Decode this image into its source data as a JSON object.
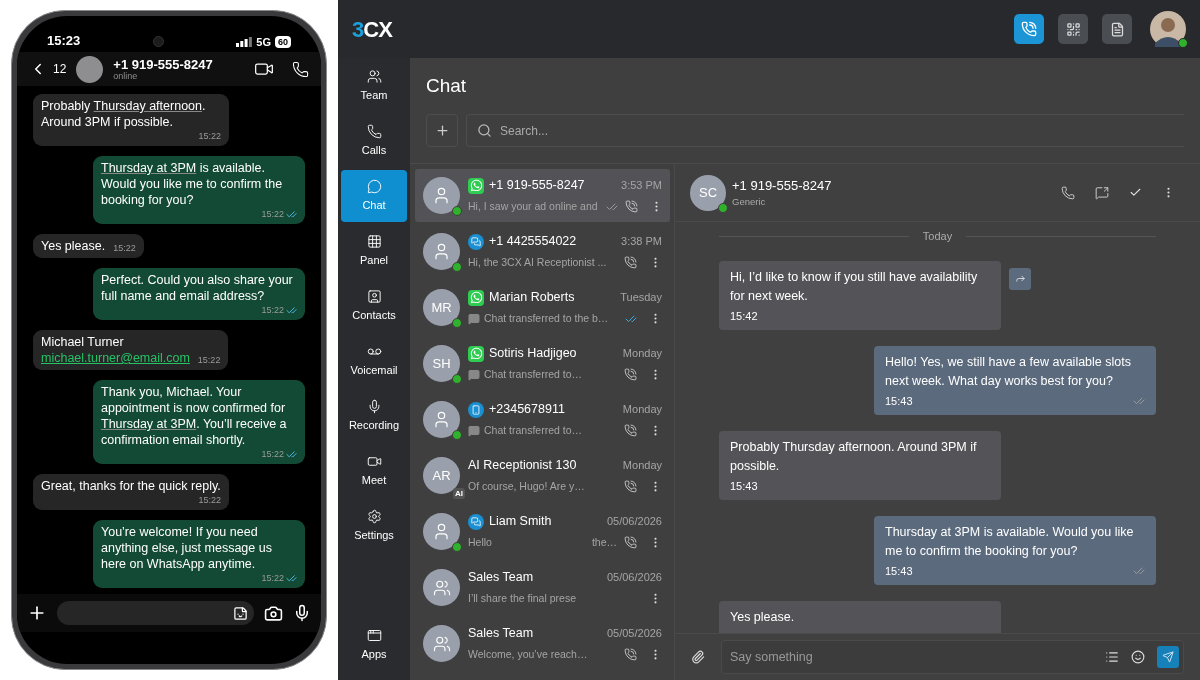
{
  "phone": {
    "status_bar": {
      "time": "15:23",
      "network": "5G",
      "battery": "60"
    },
    "header": {
      "back_count": "12",
      "contact": "+1 919-555-8247",
      "presence": "online"
    },
    "messages": [
      {
        "kind": "incoming",
        "parts": [
          {
            "text": "Probably "
          },
          {
            "text": "Thursday afternoon",
            "underlined": true
          },
          {
            "text": ". Around 3PM if possible.",
            "underlined": false
          }
        ],
        "time": "15:22"
      },
      {
        "kind": "outgoing",
        "parts": [
          {
            "text": "Thursday at 3PM",
            "underlined": true
          },
          {
            "text": " is available. Would you like me to confirm the booking for you?",
            "underlined": false
          }
        ],
        "time": "15:22",
        "read": true
      },
      {
        "kind": "incoming",
        "parts": [
          {
            "text": "Yes please.",
            "underlined": false
          }
        ],
        "time": "15:22"
      },
      {
        "kind": "outgoing",
        "parts": [
          {
            "text": "Perfect. Could you also share your full name and email address?",
            "underlined": false
          }
        ],
        "time": "15:22",
        "read": true
      },
      {
        "kind": "incoming",
        "parts": [
          {
            "text": "Michael Turner",
            "underlined": false
          },
          {
            "kind": "link",
            "text": "michael.turner@email.com"
          }
        ],
        "time": "15:22"
      },
      {
        "kind": "outgoing",
        "parts": [
          {
            "text": "Thank you, Michael. Your appointment is now confirmed for ",
            "underlined": false
          },
          {
            "text": "Thursday at 3PM",
            "underlined": true
          },
          {
            "text": ". You’ll receive a confirmation email shortly.",
            "underlined": false
          }
        ],
        "time": "15:22",
        "read": true
      },
      {
        "kind": "incoming",
        "parts": [
          {
            "text": "Great, thanks for the quick reply.",
            "underlined": false
          }
        ],
        "time": "15:22"
      },
      {
        "kind": "outgoing",
        "parts": [
          {
            "text": "You’re welcome! If you need anything else, just message us here on WhatsApp anytime.",
            "underlined": false
          }
        ],
        "time": "15:22",
        "read": true
      }
    ]
  },
  "app": {
    "logo": "3CX",
    "nav": [
      {
        "label": "Team",
        "selected": false
      },
      {
        "label": "Calls",
        "selected": false
      },
      {
        "label": "Chat",
        "selected": true
      },
      {
        "label": "Panel",
        "selected": false
      },
      {
        "label": "Contacts",
        "selected": false
      },
      {
        "label": "Voicemail",
        "selected": false
      },
      {
        "label": "Recording",
        "selected": false
      },
      {
        "label": "Meet",
        "selected": false
      },
      {
        "label": "Settings",
        "selected": false
      }
    ],
    "nav_bottom": {
      "label": "Apps"
    },
    "page_title": "Chat",
    "search": {
      "placeholder": "Search..."
    },
    "chats": [
      {
        "name": "+1 919-555-8247",
        "channel": {
          "kind": "whatsapp"
        },
        "avatar": {
          "kind": "person"
        },
        "online": true,
        "time": "3:53 PM",
        "preview": {
          "text": "Hi, I saw your ad online and"
        },
        "ticks": true,
        "read": false,
        "call": true,
        "selected": true
      },
      {
        "name": "+1 4425554022",
        "channel": {
          "kind": "livechat"
        },
        "avatar": {
          "kind": "person"
        },
        "online": true,
        "time": "3:38 PM",
        "preview": {
          "text": "Hi, the 3CX AI Receptionist ..."
        },
        "ticks": false,
        "call": true,
        "selected": false
      },
      {
        "name": "Marian Roberts",
        "channel": {
          "kind": "whatsapp"
        },
        "avatar": {
          "kind": "initials",
          "initials": "MR"
        },
        "online": true,
        "time": "Tuesday",
        "preview": {
          "kind": "transfer",
          "text": "Chat transferred to the b…"
        },
        "ticks": true,
        "read": true,
        "call": false,
        "selected": false
      },
      {
        "name": "Sotiris Hadjigeo",
        "channel": {
          "kind": "whatsapp"
        },
        "avatar": {
          "kind": "initials",
          "initials": "SH"
        },
        "online": true,
        "time": "Monday",
        "preview": {
          "kind": "transfer",
          "text": "Chat transferred to…"
        },
        "ticks": false,
        "call": true,
        "selected": false
      },
      {
        "name": "+2345678911",
        "channel": {
          "kind": "sms"
        },
        "avatar": {
          "kind": "person"
        },
        "online": true,
        "time": "Monday",
        "preview": {
          "kind": "transfer",
          "text": "Chat transferred to…"
        },
        "ticks": false,
        "call": true,
        "selected": false
      },
      {
        "name": "AI Receptionist 130",
        "avatar": {
          "kind": "initials",
          "initials": "AR",
          "badge": "AI"
        },
        "online": false,
        "time": "Monday",
        "preview": {
          "text": "Of course, Hugo! Are y…"
        },
        "ticks": false,
        "call": true,
        "selected": false
      },
      {
        "name": "Liam Smith",
        "channel": {
          "kind": "livechat"
        },
        "avatar": {
          "kind": "person"
        },
        "online": true,
        "time": "05/06/2026",
        "preview": {
          "text": "Hello",
          "tail": "the…"
        },
        "ticks": false,
        "call": true,
        "selected": false
      },
      {
        "name": "Sales Team",
        "avatar": {
          "kind": "group"
        },
        "online": false,
        "time": "05/06/2026",
        "preview": {
          "text": "I’ll share the final prese"
        },
        "ticks": false,
        "call": false,
        "selected": false
      },
      {
        "name": "Sales Team",
        "avatar": {
          "kind": "group"
        },
        "online": false,
        "time": "05/05/2026",
        "preview": {
          "text": "Welcome, you’ve reach…"
        },
        "ticks": false,
        "call": true,
        "selected": false
      }
    ],
    "conversation": {
      "name": "+1 919-555-8247",
      "subtitle": "Generic",
      "initials": "SC",
      "online": true,
      "date": "Today",
      "messages": [
        {
          "kind": "incoming",
          "text": "Hi, I’d like to know if you still have availability for next week.",
          "time": "15:42",
          "forward": true
        },
        {
          "kind": "outgoing",
          "text": "Hello! Yes, we still have a few available slots next week. What day works best for you?",
          "time": "15:43",
          "ticks": true
        },
        {
          "kind": "incoming",
          "text": "Probably Thursday afternoon. Around 3PM if possible.",
          "time": "15:43",
          "forward": false
        },
        {
          "kind": "outgoing",
          "text": "Thursday at 3PM is available. Would you like me to confirm the booking for you?",
          "time": "15:43",
          "ticks": true
        },
        {
          "kind": "incoming",
          "text": "Yes please.",
          "forward": false
        }
      ],
      "composer": {
        "placeholder": "Say something"
      }
    }
  }
}
